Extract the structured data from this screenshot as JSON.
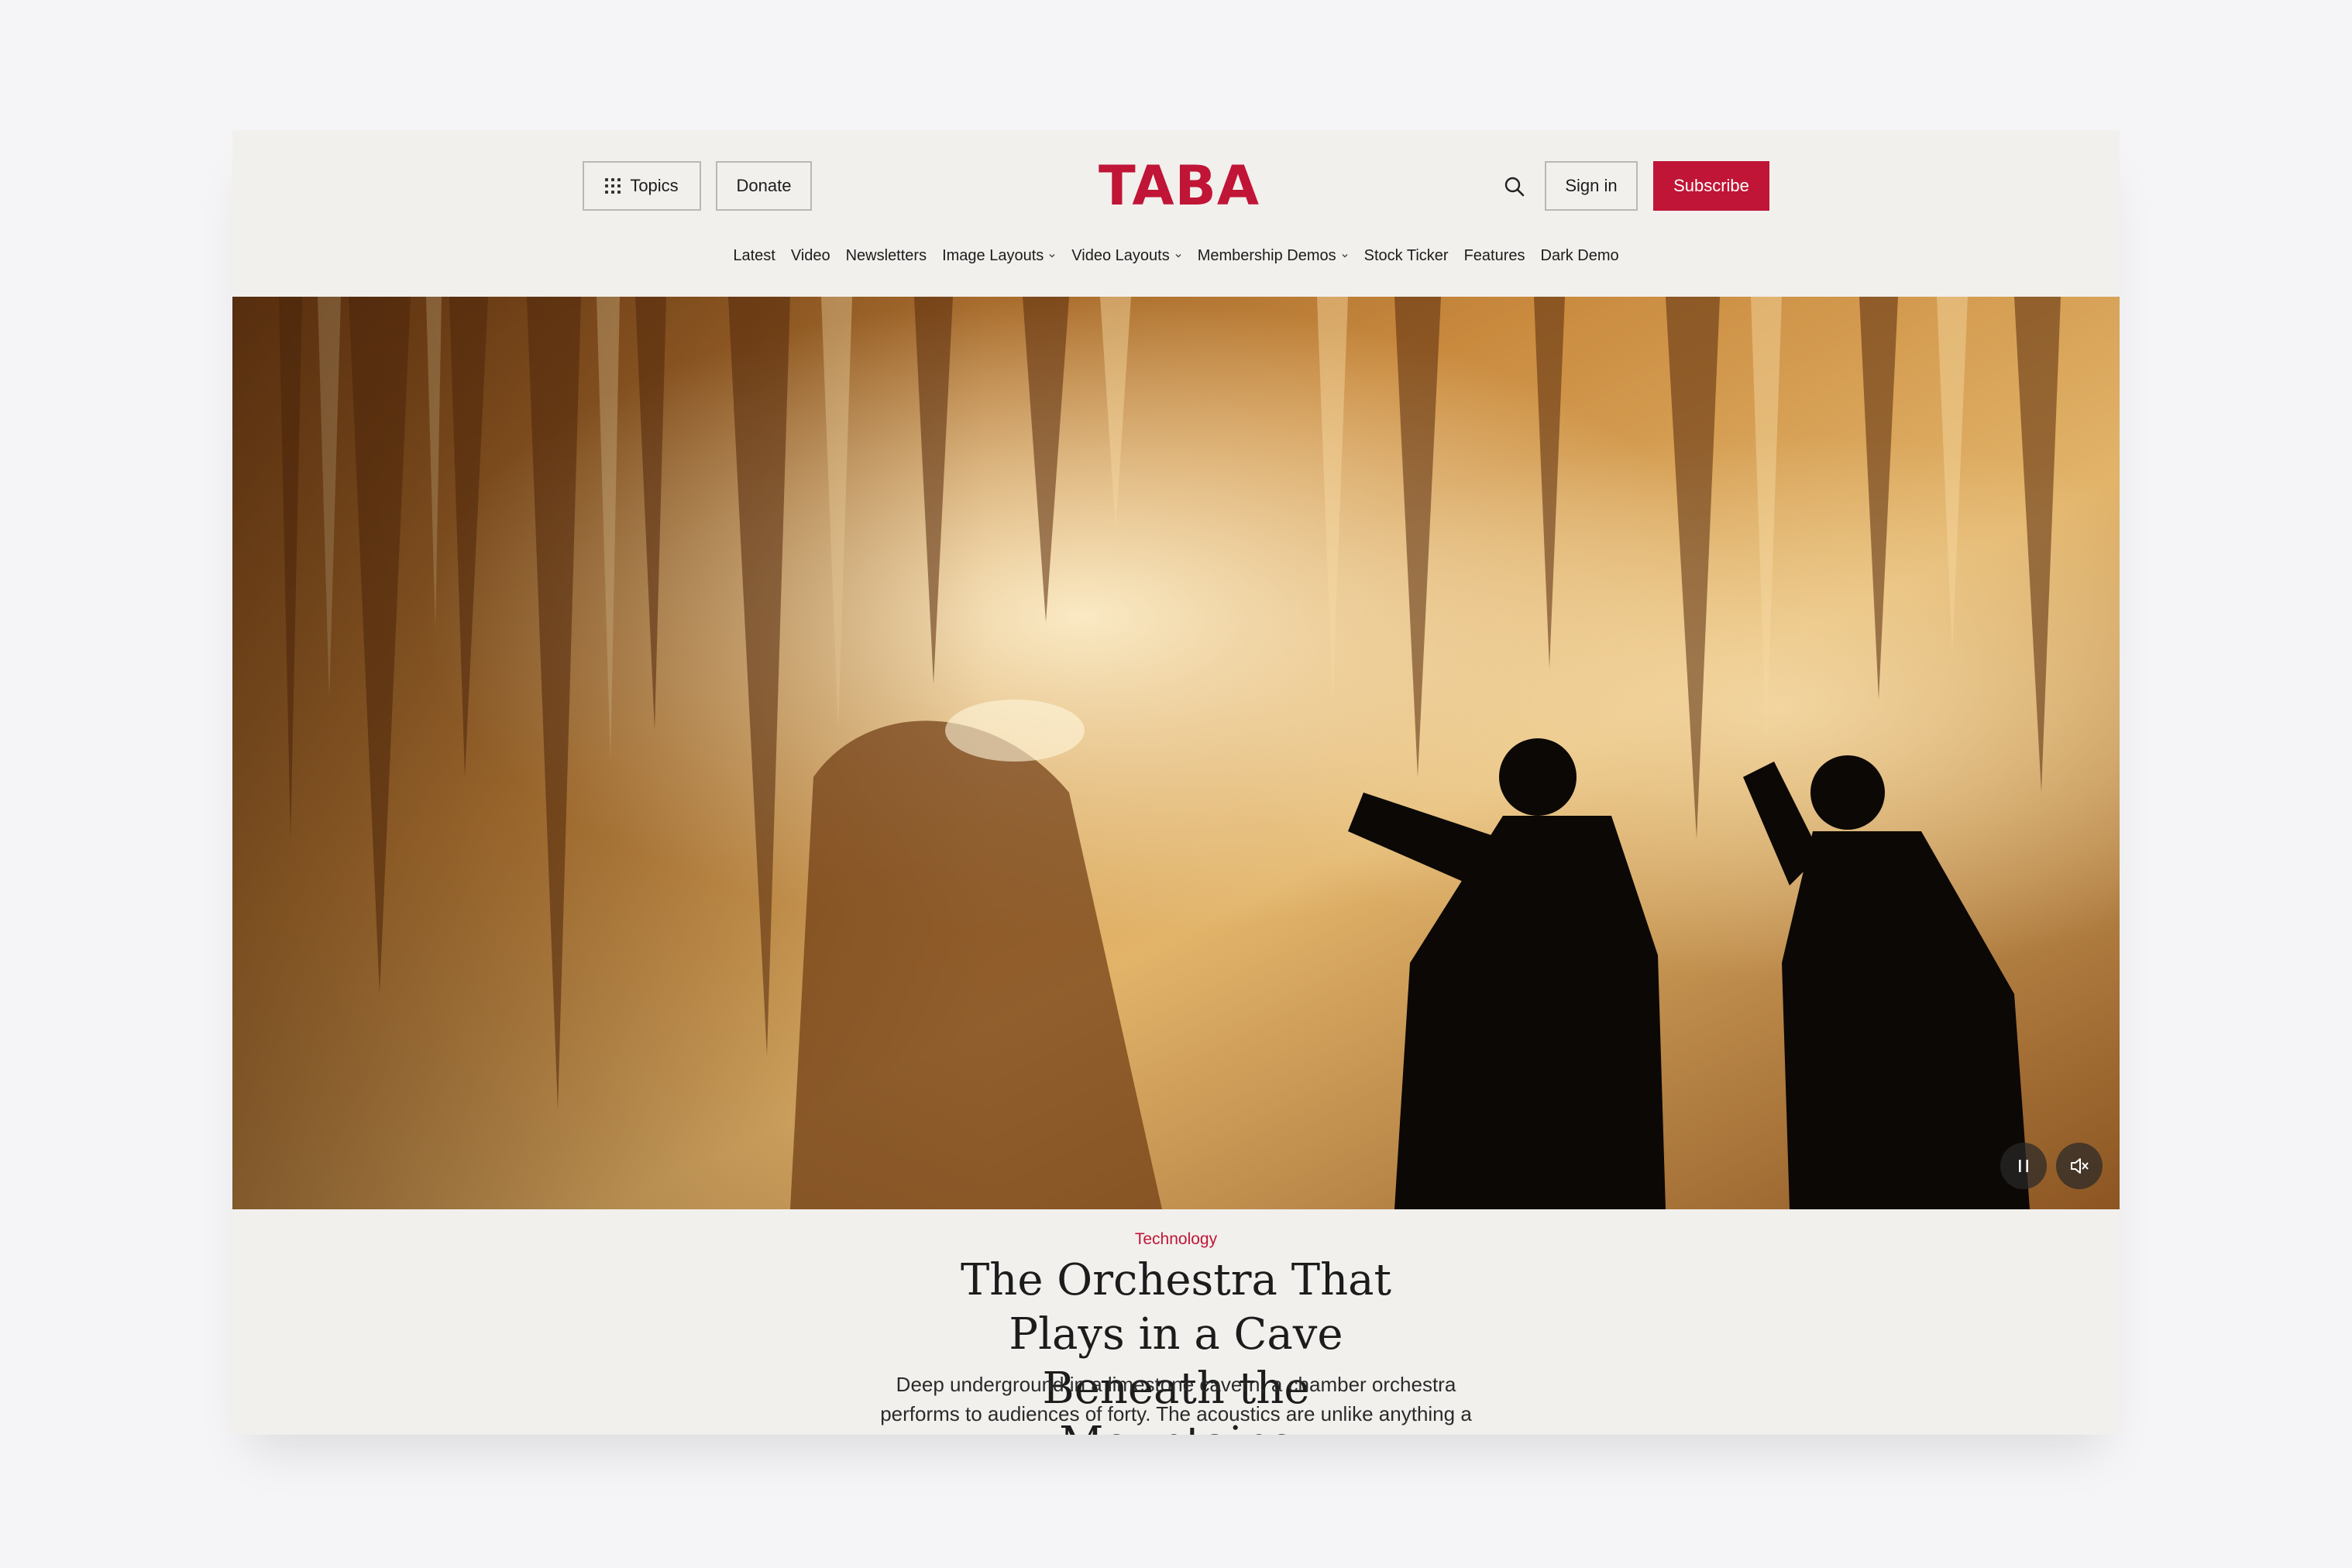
{
  "header": {
    "topics_label": "Topics",
    "donate_label": "Donate",
    "logo": "TABA",
    "signin_label": "Sign in",
    "subscribe_label": "Subscribe"
  },
  "nav": {
    "items": [
      {
        "label": "Latest",
        "dropdown": false
      },
      {
        "label": "Video",
        "dropdown": false
      },
      {
        "label": "Newsletters",
        "dropdown": false
      },
      {
        "label": "Image Layouts",
        "dropdown": true
      },
      {
        "label": "Video Layouts",
        "dropdown": true
      },
      {
        "label": "Membership Demos",
        "dropdown": true
      },
      {
        "label": "Stock Ticker",
        "dropdown": false
      },
      {
        "label": "Features",
        "dropdown": false
      },
      {
        "label": "Dark Demo",
        "dropdown": false
      }
    ]
  },
  "hero": {
    "controls": {
      "pause_icon": "pause-icon",
      "mute_icon": "mute-icon"
    }
  },
  "article": {
    "category": "Technology",
    "headline": "The Orchestra That Plays in a Cave Beneath the Mountains",
    "dek": "Deep underground in a limestone cavern, a chamber orchestra performs to audiences of forty. The acoustics are unlike anything a concert hall can"
  },
  "colors": {
    "brand": "#c01536",
    "page_bg": "#f1f0ed"
  }
}
